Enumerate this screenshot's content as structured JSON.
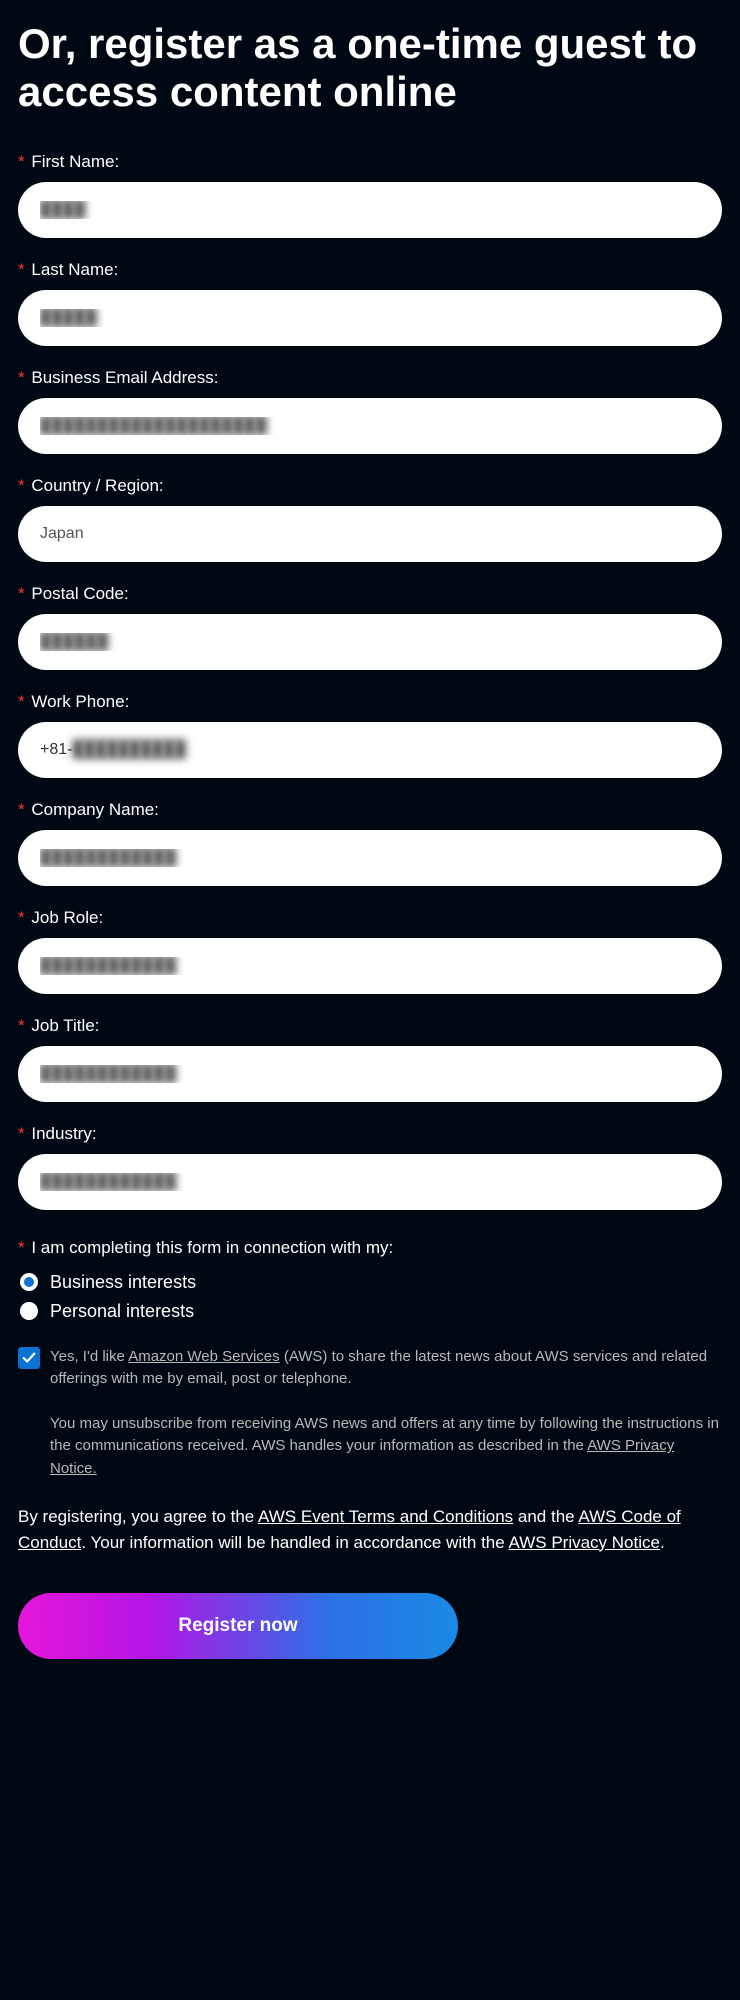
{
  "heading": "Or, register as a one-time guest to access content online",
  "fields": {
    "first_name": {
      "label": "First Name:",
      "value": "████"
    },
    "last_name": {
      "label": "Last Name:",
      "value": "█████"
    },
    "email": {
      "label": "Business Email Address:",
      "value": "████████████████████"
    },
    "country": {
      "label": "Country / Region:",
      "value": "Japan"
    },
    "postal": {
      "label": "Postal Code:",
      "value": "██████"
    },
    "phone": {
      "label": "Work Phone:",
      "prefix": "+81- ",
      "value": "██████████"
    },
    "company": {
      "label": "Company Name:",
      "value": "████████████"
    },
    "job_role": {
      "label": "Job Role:",
      "value": "████████████"
    },
    "job_title": {
      "label": "Job Title:",
      "value": "████████████"
    },
    "industry": {
      "label": "Industry:",
      "value": "████████████"
    }
  },
  "interests": {
    "label": "I am completing this form in connection with my:",
    "options": {
      "business": "Business interests",
      "personal": "Personal interests"
    },
    "selected": "business"
  },
  "consent": {
    "prefix": "Yes, I'd like ",
    "link1_text": "Amazon Web Services",
    "suffix": " (AWS) to share the latest news about AWS services and related offerings with me by email, post or telephone."
  },
  "unsubscribe": {
    "text": "You may unsubscribe from receiving AWS news and offers at any time by following the instructions in the communications received. AWS handles your information as described in the ",
    "link_text": "AWS Privacy Notice."
  },
  "agreement": {
    "part1": "By registering, you agree to the ",
    "link1": "AWS Event Terms and Conditions",
    "part2": " and the ",
    "link2": "AWS Code of Conduct",
    "part3": ". Your information will be handled in accordance with the ",
    "link3": "AWS Privacy Notice",
    "part4": "."
  },
  "button": {
    "register": "Register now"
  }
}
